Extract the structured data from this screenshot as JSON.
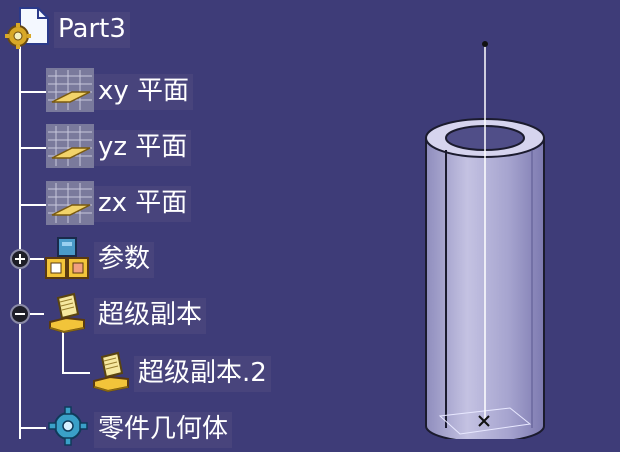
{
  "tree": {
    "root": {
      "label": "Part3",
      "icon": "part-document-icon"
    },
    "items": [
      {
        "label": "xy 平面",
        "icon": "plane-icon"
      },
      {
        "label": "yz 平面",
        "icon": "plane-icon"
      },
      {
        "label": "zx 平面",
        "icon": "plane-icon"
      },
      {
        "label": "参数",
        "icon": "parameters-icon",
        "expander": "collapsed"
      },
      {
        "label": "超级副本",
        "icon": "hand-book-icon",
        "expander": "expanded"
      },
      {
        "label": "超级副本.2",
        "icon": "hand-book-icon"
      },
      {
        "label": "零件几何体",
        "icon": "body-gear-icon"
      }
    ]
  },
  "colors": {
    "background": "#3e3c78",
    "label_background": "#48447c",
    "text": "#ffffff",
    "cylinder": "#a9a7cf"
  }
}
